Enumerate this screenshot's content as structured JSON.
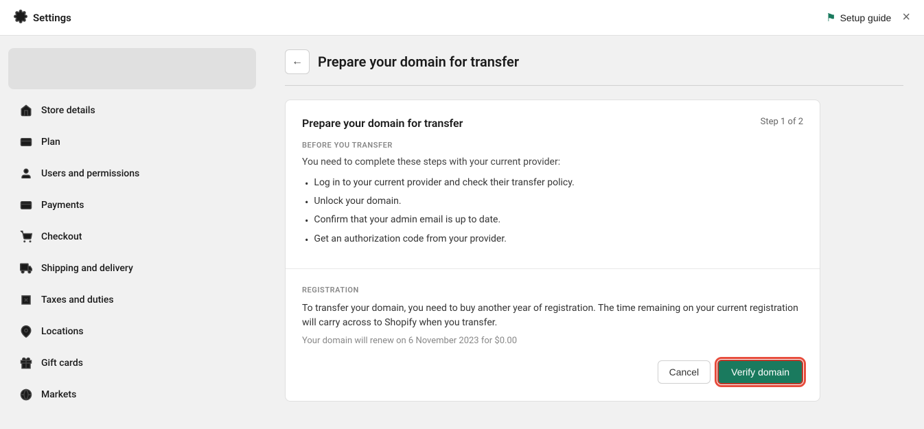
{
  "topbar": {
    "settings_label": "Settings",
    "setup_guide_label": "Setup guide",
    "close_label": "×"
  },
  "sidebar": {
    "items": [
      {
        "id": "store-details",
        "label": "Store details",
        "icon": "store"
      },
      {
        "id": "plan",
        "label": "Plan",
        "icon": "plan"
      },
      {
        "id": "users-and-permissions",
        "label": "Users and permissions",
        "icon": "user"
      },
      {
        "id": "payments",
        "label": "Payments",
        "icon": "payment"
      },
      {
        "id": "checkout",
        "label": "Checkout",
        "icon": "checkout"
      },
      {
        "id": "shipping-and-delivery",
        "label": "Shipping and delivery",
        "icon": "shipping"
      },
      {
        "id": "taxes-and-duties",
        "label": "Taxes and duties",
        "icon": "taxes"
      },
      {
        "id": "locations",
        "label": "Locations",
        "icon": "location"
      },
      {
        "id": "gift-cards",
        "label": "Gift cards",
        "icon": "gift"
      },
      {
        "id": "markets",
        "label": "Markets",
        "icon": "markets"
      }
    ]
  },
  "page": {
    "title": "Prepare your domain for transfer",
    "back_label": "←"
  },
  "card": {
    "section1": {
      "title": "Prepare your domain for transfer",
      "step": "Step 1 of 2",
      "before_label": "BEFORE YOU TRANSFER",
      "subtitle": "You need to complete these steps with your current provider:",
      "bullets": [
        "Log in to your current provider and check their transfer policy.",
        "Unlock your domain.",
        "Confirm that your admin email is up to date.",
        "Get an authorization code from your provider."
      ]
    },
    "section2": {
      "registration_label": "REGISTRATION",
      "text": "To transfer your domain, you need to buy another year of registration. The time remaining on your current registration will carry across to Shopify when you transfer.",
      "note": "Your domain will renew on 6 November 2023 for $0.00",
      "cancel_label": "Cancel",
      "verify_label": "Verify domain"
    }
  }
}
